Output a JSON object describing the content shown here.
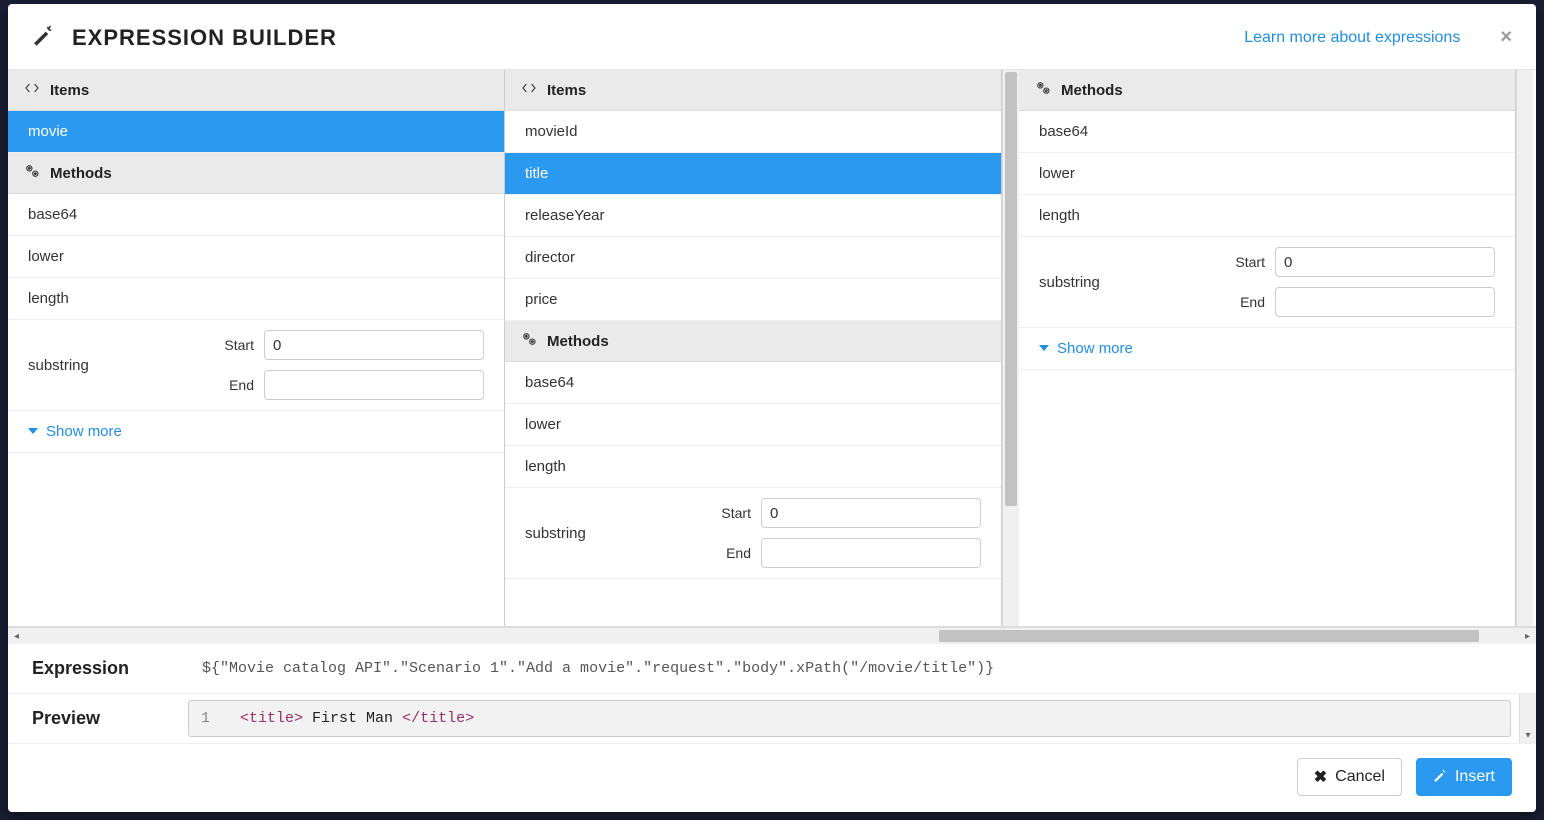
{
  "header": {
    "title": "EXPRESSION BUILDER",
    "learn_link": "Learn more about expressions",
    "close_glyph": "×"
  },
  "panel1": {
    "items_head": "Items",
    "items": [
      "movie"
    ],
    "selected_item_index": 0,
    "methods_head": "Methods",
    "methods": [
      "base64",
      "lower",
      "length"
    ],
    "substring": {
      "name": "substring",
      "start_label": "Start",
      "start_value": "0",
      "end_label": "End",
      "end_value": ""
    },
    "show_more": "Show more"
  },
  "panel2": {
    "items_head": "Items",
    "items": [
      "movieId",
      "title",
      "releaseYear",
      "director",
      "price"
    ],
    "selected_item_index": 1,
    "methods_head": "Methods",
    "methods": [
      "base64",
      "lower",
      "length"
    ],
    "substring": {
      "name": "substring",
      "start_label": "Start",
      "start_value": "0",
      "end_label": "End",
      "end_value": ""
    }
  },
  "panel3": {
    "methods_head": "Methods",
    "methods": [
      "base64",
      "lower",
      "length"
    ],
    "substring": {
      "name": "substring",
      "start_label": "Start",
      "start_value": "0",
      "end_label": "End",
      "end_value": ""
    },
    "show_more": "Show more"
  },
  "expression": {
    "label": "Expression",
    "code": "${\"Movie catalog API\".\"Scenario 1\".\"Add a movie\".\"request\".\"body\".xPath(\"/movie/title\")}"
  },
  "preview": {
    "label": "Preview",
    "line_number": "1",
    "tag_open": "<title>",
    "text": " First Man ",
    "tag_close": "</title>"
  },
  "actions": {
    "cancel": "Cancel",
    "insert": "Insert"
  }
}
